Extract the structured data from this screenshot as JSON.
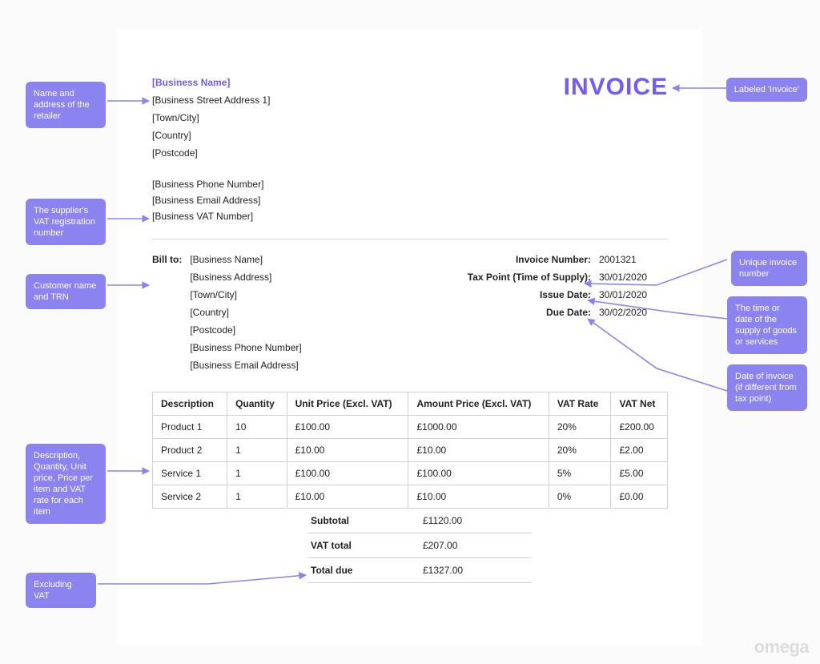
{
  "invoiceTitle": "INVOICE",
  "supplier": {
    "name": "[Business Name]",
    "addr1": "[Business Street Address 1]",
    "town": "[Town/City]",
    "country": "[Country]",
    "postcode": "[Postcode]",
    "phone": "[Business Phone Number]",
    "email": "[Business Email Address]",
    "vat": "[Business VAT Number]"
  },
  "billToLabel": "Bill to:",
  "billTo": {
    "name": "[Business Name]",
    "address": "[Business Address]",
    "town": "[Town/City]",
    "country": "[Country]",
    "postcode": "[Postcode]",
    "phone": "[Business Phone Number]",
    "email": "[Business Email Address]"
  },
  "meta": {
    "invoiceNumber": {
      "label": "Invoice Number:",
      "value": "2001321"
    },
    "taxPoint": {
      "label": "Tax Point (Time of Supply):",
      "value": "30/01/2020"
    },
    "issueDate": {
      "label": "Issue Date:",
      "value": "30/01/2020"
    },
    "dueDate": {
      "label": "Due Date:",
      "value": "30/02/2020"
    }
  },
  "columns": {
    "description": "Description",
    "quantity": "Quantity",
    "unitPrice": "Unit Price (Excl. VAT)",
    "amount": "Amount Price (Excl. VAT)",
    "vatRate": "VAT Rate",
    "vatNet": "VAT Net"
  },
  "items": [
    {
      "description": "Product 1",
      "quantity": "10",
      "unitPrice": "£100.00",
      "amount": "£1000.00",
      "vatRate": "20%",
      "vatNet": "£200.00"
    },
    {
      "description": "Product 2",
      "quantity": "1",
      "unitPrice": "£10.00",
      "amount": "£10.00",
      "vatRate": "20%",
      "vatNet": "£2.00"
    },
    {
      "description": "Service 1",
      "quantity": "1",
      "unitPrice": "£100.00",
      "amount": "£100.00",
      "vatRate": "5%",
      "vatNet": "£5.00"
    },
    {
      "description": "Service 2",
      "quantity": "1",
      "unitPrice": "£10.00",
      "amount": "£10.00",
      "vatRate": "0%",
      "vatNet": "£0.00"
    }
  ],
  "totals": {
    "subtotal": {
      "label": "Subtotal",
      "value": "£1120.00"
    },
    "vatTotal": {
      "label": "VAT total",
      "value": "£207.00"
    },
    "totalDue": {
      "label": "Total due",
      "value": "£1327.00"
    }
  },
  "callouts": {
    "retailer": "Name and address of the retailer",
    "vatReg": "The supplier's VAT registration number",
    "customer": "Customer name and TRN",
    "lineItems": "Description, Quantity, Unit price, Price per item and VAT rate for each item",
    "exclVat": "Excluding VAT",
    "labeled": "Labeled 'Invoice'",
    "uniqueNum": "Unique invoice number",
    "taxPoint": "The time or date of the supply of goods or services",
    "issueDate": "Date of invoice (if different from tax point)"
  },
  "watermark": "omega"
}
